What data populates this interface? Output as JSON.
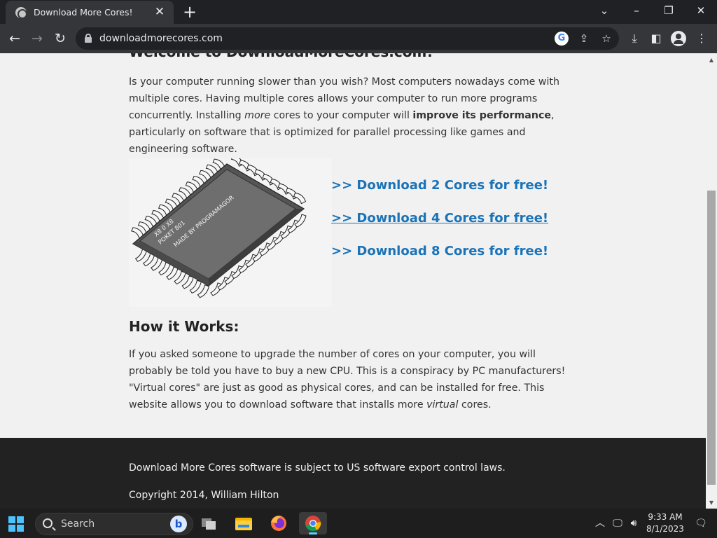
{
  "browser": {
    "tab_title": "Download More Cores!",
    "url": "downloadmorecores.com"
  },
  "page": {
    "welcome_heading": "Welcome to DownloadMoreCores.com!",
    "intro": {
      "part1": "Is your computer running slower than you wish? Most computers nowadays come with multiple cores. Having multiple cores allows your computer to run more programs concurrently. Installing ",
      "em1": "more",
      "part2": " cores to your computer will ",
      "strong1": "improve its performance",
      "part3": ", particularly on software that is optimized for parallel processing like games and engineering software."
    },
    "chip_labels": {
      "line1": "X8 0 X8",
      "line2": "POKET 801",
      "line3": "MADE BY PROGRAMAGOR"
    },
    "download_links": [
      ">> Download 2 Cores for free!",
      ">> Download 4 Cores for free!",
      ">> Download 8 Cores for free!"
    ],
    "how_heading": "How it Works:",
    "how_text": {
      "part1": "If you asked someone to upgrade the number of cores on your computer, you will probably be told you have to buy a new CPU. This is a conspiracy by PC manufacturers! \"Virtual cores\" are just as good as physical cores, and can be installed for free. This website allows you to download software that installs more ",
      "em1": "virtual",
      "part2": " cores."
    },
    "footer": {
      "line1": "Download More Cores software is subject to US software export control laws.",
      "line2": "Copyright 2014, William Hilton"
    }
  },
  "taskbar": {
    "search_label": "Search",
    "time": "9:33 AM",
    "date": "8/1/2023"
  },
  "colors": {
    "link": "#1a73b8",
    "footer_bg": "#222222",
    "page_bg": "#f1f1f1"
  }
}
